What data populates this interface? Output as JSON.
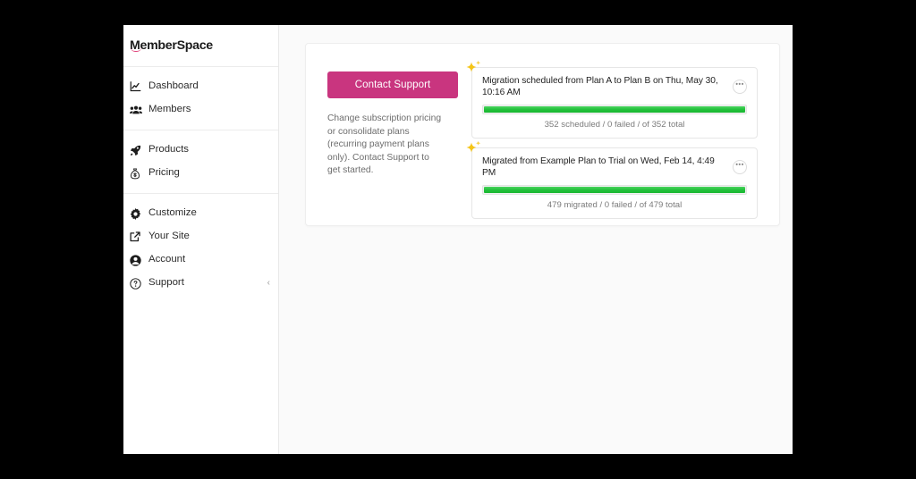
{
  "brand": {
    "logo_text": "MemberSpace",
    "accent_pink": "#c9357f",
    "logo_swoosh_color": "#e0457b"
  },
  "sidebar": {
    "groups": [
      {
        "items": [
          {
            "label": "Dashboard",
            "icon": "chart-line-icon"
          },
          {
            "label": "Members",
            "icon": "people-icon"
          }
        ]
      },
      {
        "items": [
          {
            "label": "Products",
            "icon": "rocket-icon"
          },
          {
            "label": "Pricing",
            "icon": "money-bag-icon"
          }
        ]
      },
      {
        "items": [
          {
            "label": "Customize",
            "icon": "gear-icon"
          },
          {
            "label": "Your Site",
            "icon": "external-link-icon"
          },
          {
            "label": "Account",
            "icon": "user-circle-icon"
          },
          {
            "label": "Support",
            "icon": "question-circle-icon",
            "trailing_icon": "chevron-left-icon",
            "trailing_glyph": "‹"
          }
        ]
      }
    ]
  },
  "panel": {
    "contact_button_label": "Contact Support",
    "description": "Change subscription pricing or consolidate plans (recurring payment plans only). Contact Support to get started.",
    "kebab_glyph": "•••",
    "migrations": [
      {
        "title": "Migration scheduled from Plan A to Plan B on Thu, May 30, 10:16 AM",
        "stats": "352 scheduled / 0 failed / of 352 total",
        "progress_percent": 100,
        "progress_color": "#22c03a",
        "sparkle_icon": "sparkle-icon"
      },
      {
        "title": "Migrated from Example Plan to Trial on Wed, Feb 14, 4:49 PM",
        "stats": "479 migrated / 0 failed / of 479 total",
        "progress_percent": 100,
        "progress_color": "#22c03a",
        "sparkle_icon": "sparkle-icon"
      }
    ]
  }
}
